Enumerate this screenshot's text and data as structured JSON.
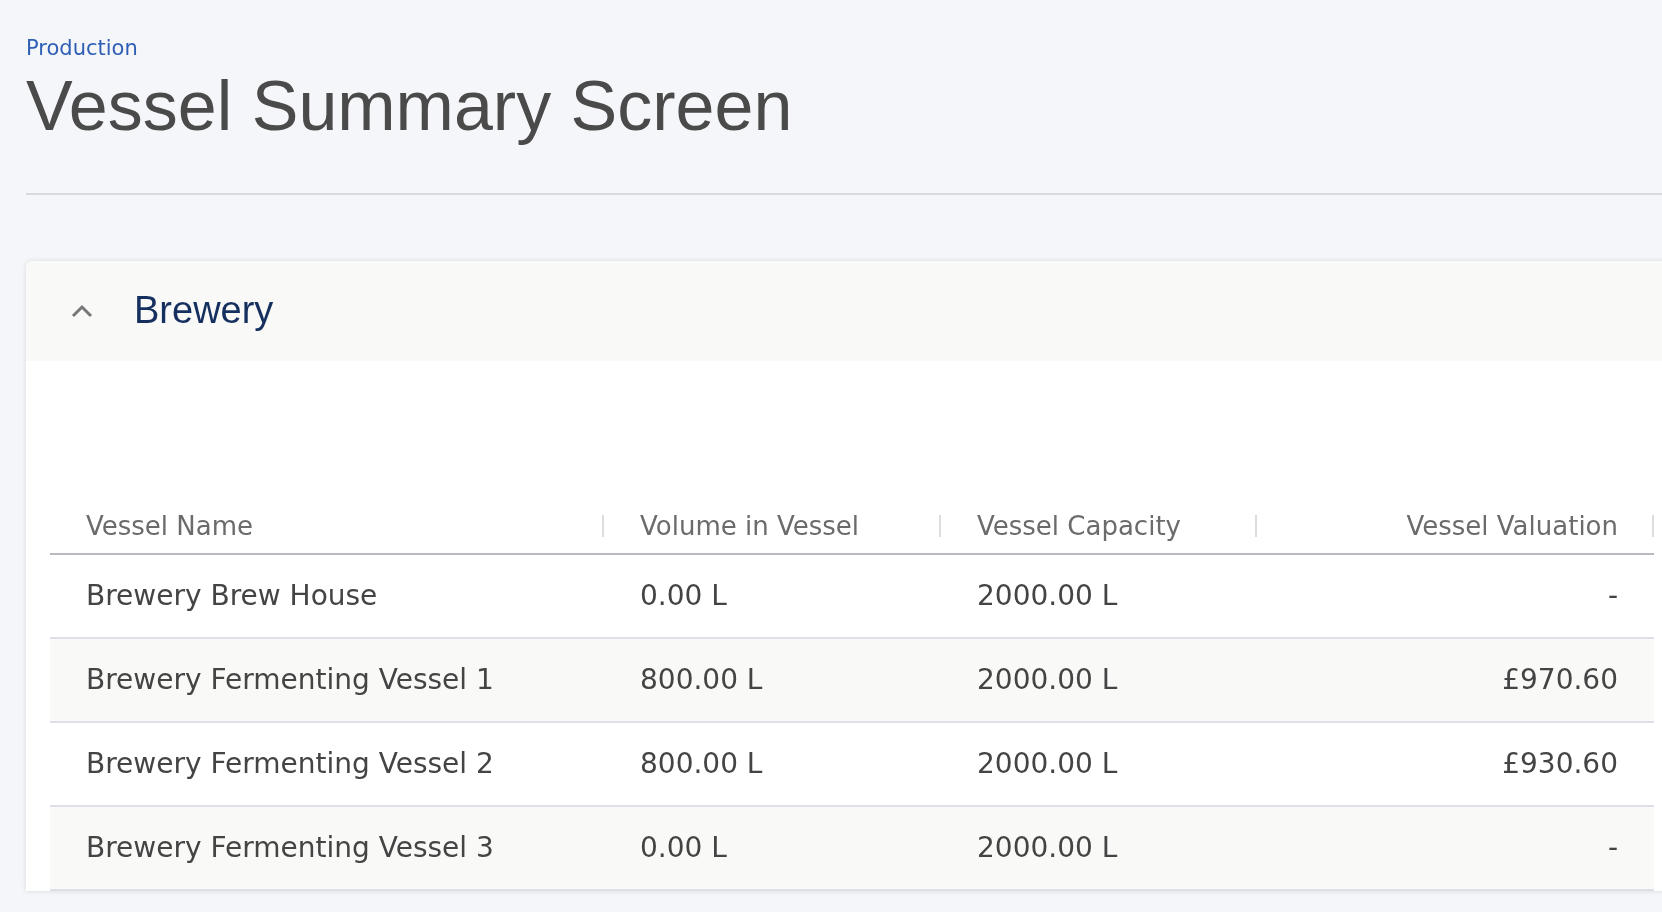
{
  "breadcrumb": "Production",
  "title": "Vessel Summary Screen",
  "section": {
    "title": "Brewery",
    "expanded": true,
    "table": {
      "columns": [
        "Vessel Name",
        "Volume in Vessel",
        "Vessel Capacity",
        "Vessel Valuation"
      ],
      "rows": [
        [
          "Brewery Brew House",
          "0.00 L",
          "2000.00 L",
          "-"
        ],
        [
          "Brewery Fermenting Vessel 1",
          "800.00 L",
          "2000.00 L",
          "£970.60"
        ],
        [
          "Brewery Fermenting Vessel 2",
          "800.00 L",
          "2000.00 L",
          "£930.60"
        ],
        [
          "Brewery Fermenting Vessel 3",
          "0.00 L",
          "2000.00 L",
          "-"
        ]
      ]
    }
  }
}
